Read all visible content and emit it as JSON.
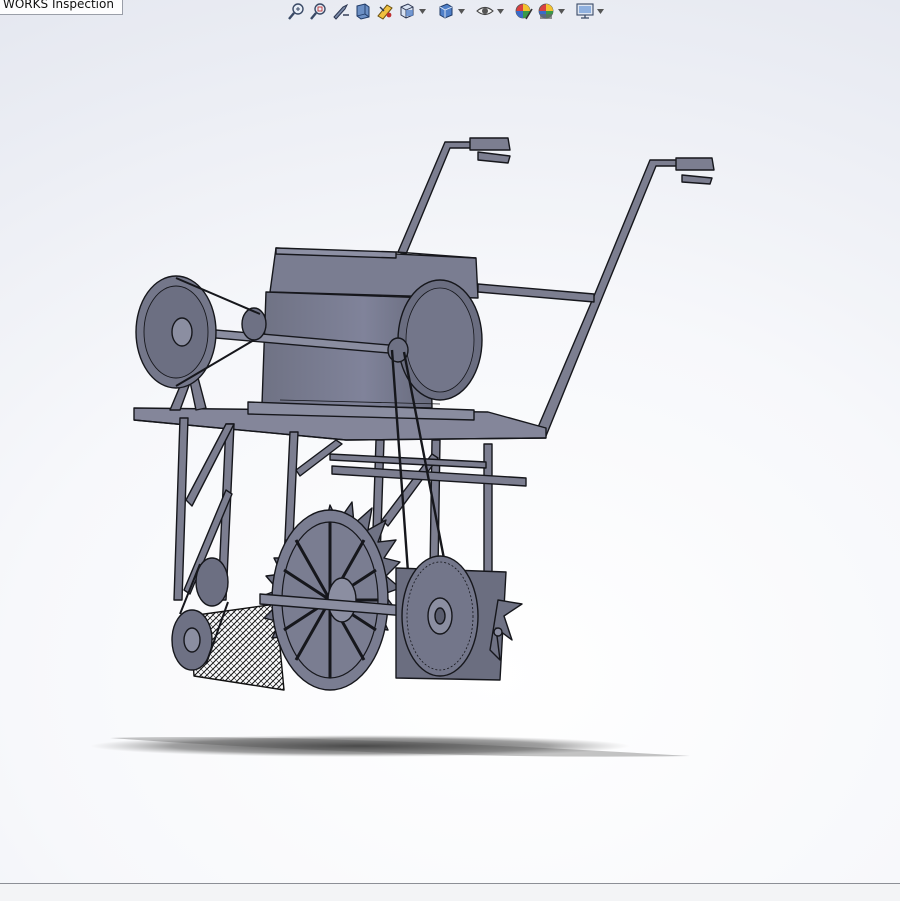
{
  "document_tab": {
    "label": "WORKS Inspection"
  },
  "toolbar": {
    "items": [
      {
        "name": "zoom-to-fit-icon",
        "has_dropdown": false
      },
      {
        "name": "zoom-to-area-icon",
        "has_dropdown": false
      },
      {
        "name": "previous-view-icon",
        "has_dropdown": false
      },
      {
        "name": "section-view-icon",
        "has_dropdown": false
      },
      {
        "name": "dynamic-annotation-icon",
        "has_dropdown": false
      },
      {
        "name": "view-orientation-icon",
        "has_dropdown": true
      },
      {
        "name": "display-style-icon",
        "has_dropdown": true
      },
      {
        "name": "hide-show-items-icon",
        "has_dropdown": true
      },
      {
        "name": "edit-appearance-icon",
        "has_dropdown": false
      },
      {
        "name": "apply-scene-icon",
        "has_dropdown": true
      },
      {
        "name": "view-settings-icon",
        "has_dropdown": true
      }
    ]
  },
  "colors": {
    "model_fill": "#7c7e90",
    "model_dark": "#3f4150",
    "model_light": "#9a9cad",
    "edge": "#16171c",
    "shadow": "#444444"
  }
}
